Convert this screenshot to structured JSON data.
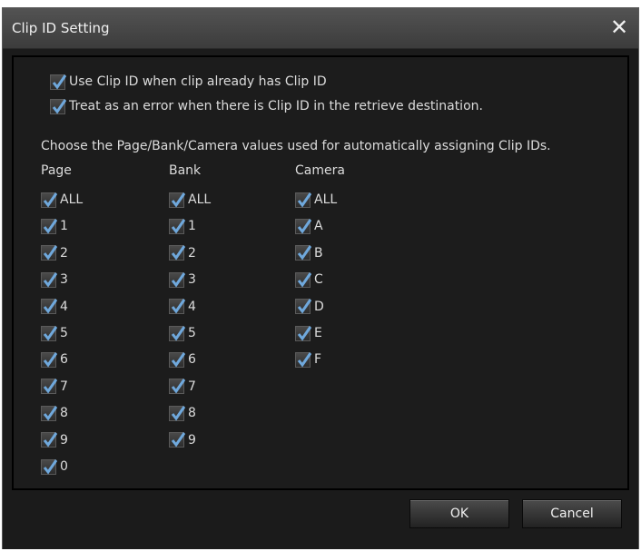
{
  "dialog": {
    "title": "Clip ID Setting",
    "close_symbol": "✕"
  },
  "options": {
    "use_clip_id": {
      "label": "Use Clip ID when clip already has Clip ID",
      "checked": true
    },
    "treat_as_error": {
      "label": "Treat as an error when there is Clip ID in the retrieve destination.",
      "checked": true
    }
  },
  "instruction": "Choose the Page/Bank/Camera values used for automatically assigning Clip IDs.",
  "columns": {
    "page": {
      "header": "Page",
      "items": [
        "ALL",
        "1",
        "2",
        "3",
        "4",
        "5",
        "6",
        "7",
        "8",
        "9",
        "0"
      ]
    },
    "bank": {
      "header": "Bank",
      "items": [
        "ALL",
        "1",
        "2",
        "3",
        "4",
        "5",
        "6",
        "7",
        "8",
        "9"
      ]
    },
    "camera": {
      "header": "Camera",
      "items": [
        "ALL",
        "A",
        "B",
        "C",
        "D",
        "E",
        "F"
      ]
    }
  },
  "buttons": {
    "ok": "OK",
    "cancel": "Cancel"
  },
  "colors": {
    "check": "#6fa8dc",
    "background": "#1b1b1b",
    "text": "#dcdcdc"
  },
  "icons": {
    "checkbox": "check-icon",
    "close": "close-icon"
  }
}
